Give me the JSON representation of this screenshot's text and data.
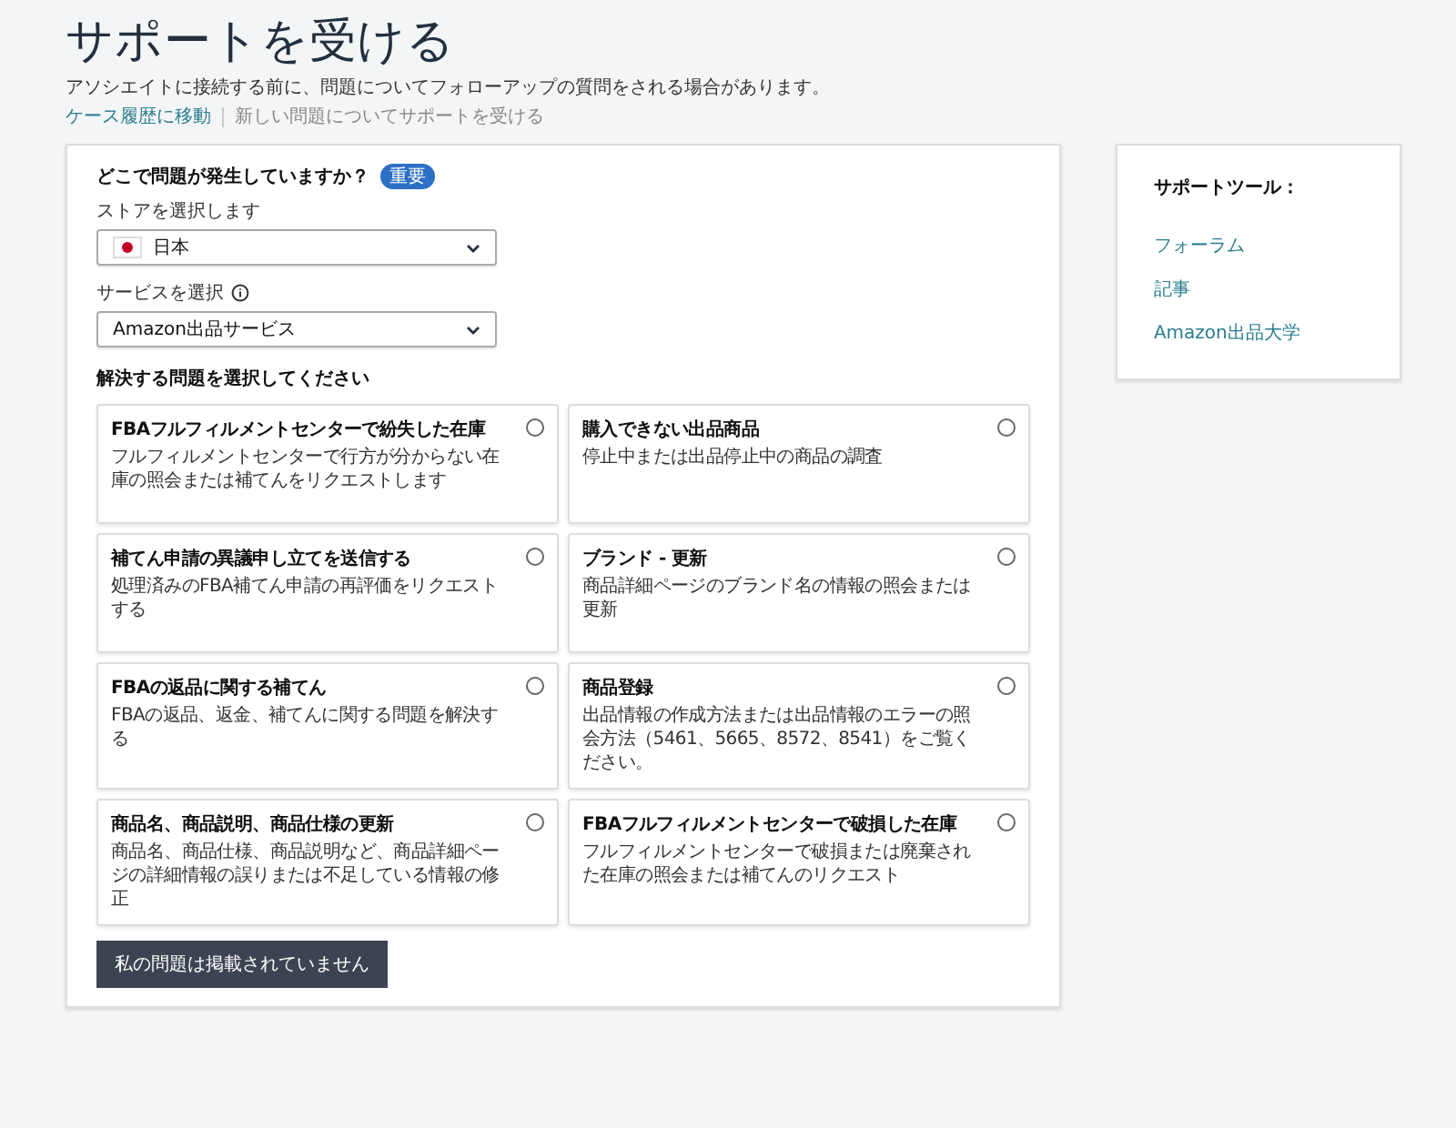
{
  "page": {
    "title": "サポートを受ける",
    "subtitle": "アソシエイトに接続する前に、問題についてフォローアップの質問をされる場合があります。",
    "breadcrumb": [
      {
        "label": "ケース履歴に移動",
        "kind": "link"
      },
      {
        "label": "新しい問題についてサポートを受ける",
        "kind": "current"
      }
    ]
  },
  "form": {
    "question": "どこで問題が発生していますか？",
    "badge": "重要",
    "store": {
      "label": "ストアを選択します",
      "value": "日本"
    },
    "service": {
      "label": "サービスを選択",
      "value": "Amazon出品サービス"
    },
    "issues_heading": "解決する問題を選択してください",
    "issues": [
      {
        "title": "FBAフルフィルメントセンターで紛失した在庫",
        "description": "フルフィルメントセンターで行方が分からない在庫の照会または補てんをリクエストします",
        "selected": false
      },
      {
        "title": "購入できない出品商品",
        "description": "停止中または出品停止中の商品の調査",
        "selected": false
      },
      {
        "title": "補てん申請の異議申し立てを送信する",
        "description": "処理済みのFBA補てん申請の再評価をリクエストする",
        "selected": false
      },
      {
        "title": "ブランド - 更新",
        "description": "商品詳細ページのブランド名の情報の照会または更新",
        "selected": false
      },
      {
        "title": "FBAの返品に関する補てん",
        "description": "FBAの返品、返金、補てんに関する問題を解決する",
        "selected": false
      },
      {
        "title": "商品登録",
        "description": "出品情報の作成方法または出品情報のエラーの照会方法（5461、5665、8572、8541）をご覧ください。",
        "selected": false
      },
      {
        "title": "商品名、商品説明、商品仕様の更新",
        "description": "商品名、商品仕様、商品説明など、商品詳細ページの詳細情報の誤りまたは不足している情報の修正",
        "selected": false
      },
      {
        "title": "FBAフルフィルメントセンターで破損した在庫",
        "description": "フルフィルメントセンターで破損または廃棄された在庫の照会または補てんのリクエスト",
        "selected": false
      }
    ],
    "not_listed_button": "私の問題は掲載されていません"
  },
  "sidebar": {
    "title": "サポートツール：",
    "links": [
      "フォーラム",
      "記事",
      "Amazon出品大学"
    ]
  }
}
